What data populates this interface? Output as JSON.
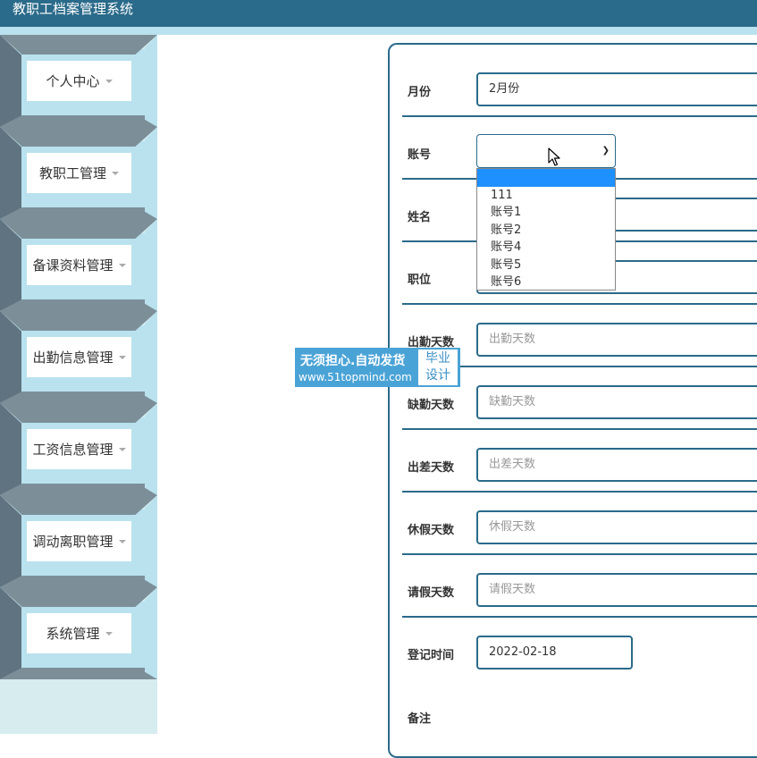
{
  "header": {
    "title": "教职工档案管理系统"
  },
  "sidebar": {
    "items": [
      {
        "label": "个人中心"
      },
      {
        "label": "教职工管理"
      },
      {
        "label": "备课资料管理"
      },
      {
        "label": "出勤信息管理"
      },
      {
        "label": "工资信息管理"
      },
      {
        "label": "调动离职管理"
      },
      {
        "label": "系统管理"
      }
    ]
  },
  "form": {
    "month": {
      "label": "月份",
      "value": "2月份"
    },
    "account": {
      "label": "账号",
      "options": [
        "",
        "111",
        "账号1",
        "账号2",
        "账号4",
        "账号5",
        "账号6"
      ],
      "selected_index": 0
    },
    "name": {
      "label": "姓名"
    },
    "position": {
      "label": "职位"
    },
    "attendance_days": {
      "label": "出勤天数",
      "placeholder": "出勤天数"
    },
    "absence_days": {
      "label": "缺勤天数",
      "placeholder": "缺勤天数"
    },
    "business_trip_days": {
      "label": "出差天数",
      "placeholder": "出差天数"
    },
    "vacation_days": {
      "label": "休假天数",
      "placeholder": "休假天数"
    },
    "leave_days": {
      "label": "请假天数",
      "placeholder": "请假天数"
    },
    "register_time": {
      "label": "登记时间",
      "value": "2022-02-18"
    },
    "remarks": {
      "label": "备注"
    }
  },
  "watermark": {
    "line1": "无须担心.自动发货",
    "line2": "www.51topmind.com",
    "box_line1": "毕业",
    "box_line2": "设计"
  },
  "colors": {
    "header": "#2a6a8a",
    "accent": "#b9e2ee",
    "border": "#2a6a8a",
    "selected": "#1e90ff"
  }
}
